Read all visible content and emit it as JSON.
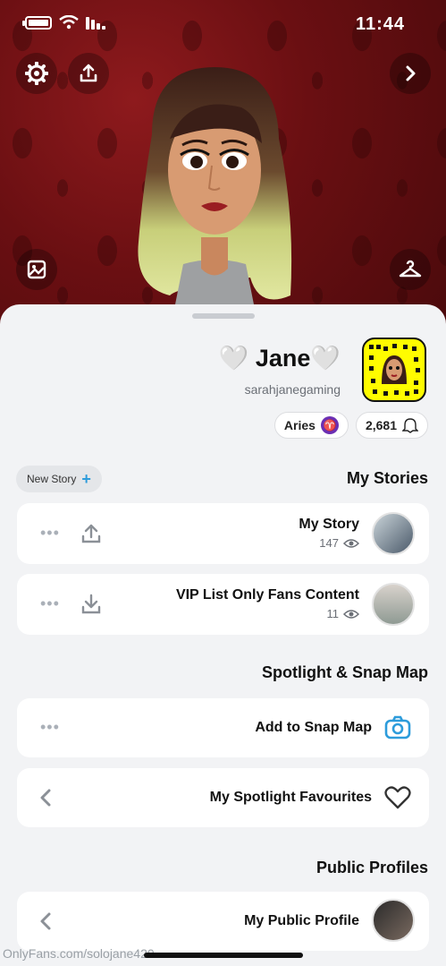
{
  "status_bar": {
    "time": "11:44"
  },
  "profile": {
    "display_name": "🤍 Jane🤍",
    "username": "sarahjanegaming",
    "snapscore": "2,681",
    "zodiac": "Aries"
  },
  "stories": {
    "section_title": "My Stories",
    "new_story_label": "New Story",
    "items": [
      {
        "title": "My Story",
        "views": "147"
      },
      {
        "title": "VIP List Only Fans Content",
        "views": "11"
      }
    ]
  },
  "spotlight": {
    "section_title": "Spotlight & Snap Map",
    "items": [
      {
        "title": "Add to Snap Map"
      },
      {
        "title": "My Spotlight Favourites"
      }
    ]
  },
  "public_profiles": {
    "section_title": "Public Profiles",
    "items": [
      {
        "title": "My Public Profile"
      }
    ]
  },
  "watermark": "OnlyFans.com/solojane420",
  "colors": {
    "header_bg": "#6a0f12",
    "snapcode_yellow": "#fffc00",
    "accent_blue": "#2d9cdb",
    "zodiac_purple": "#6b2fb3"
  },
  "icons": [
    "battery-icon",
    "wifi-icon",
    "signal-icon",
    "gear-icon",
    "share-icon",
    "chevron-right-icon",
    "photo-icon",
    "hanger-icon",
    "ghost-icon",
    "eye-icon",
    "download-icon",
    "upload-icon",
    "camera-icon",
    "heart-icon",
    "chevron-left-icon"
  ]
}
